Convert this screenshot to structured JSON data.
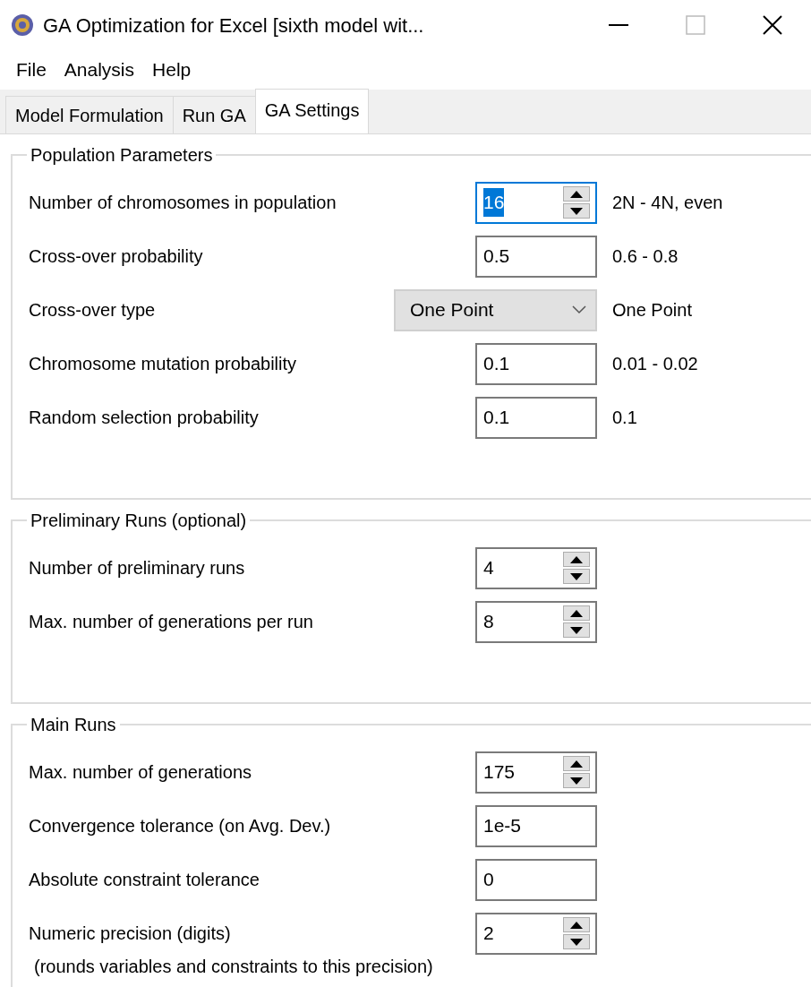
{
  "window": {
    "title": "GA Optimization for Excel [sixth model wit..."
  },
  "menu": [
    "File",
    "Analysis",
    "Help"
  ],
  "tabs": [
    {
      "label": "Model Formulation",
      "selected": false
    },
    {
      "label": "Run GA",
      "selected": false
    },
    {
      "label": "GA Settings",
      "selected": true
    }
  ],
  "groups": [
    {
      "title": "Population Parameters",
      "rows": [
        {
          "kind": "spin",
          "label": "Number of chromosomes in population",
          "value": "16",
          "hint": "2N - 4N, even",
          "focused": true
        },
        {
          "kind": "text",
          "label": "Cross-over probability",
          "value": "0.5",
          "hint": "0.6 - 0.8"
        },
        {
          "kind": "select",
          "label": "Cross-over type",
          "value": "One Point",
          "hint": "One Point"
        },
        {
          "kind": "text",
          "label": "Chromosome mutation probability",
          "value": "0.1",
          "hint": "0.01 - 0.02"
        },
        {
          "kind": "text",
          "label": "Random selection probability",
          "value": "0.1",
          "hint": "0.1"
        }
      ]
    },
    {
      "title": "Preliminary Runs (optional)",
      "rows": [
        {
          "kind": "spin",
          "label": "Number of preliminary runs",
          "value": "4"
        },
        {
          "kind": "spin",
          "label": "Max. number of generations per run",
          "value": "8"
        }
      ]
    },
    {
      "title": "Main Runs",
      "rows": [
        {
          "kind": "spin",
          "label": "Max. number of generations",
          "value": "175"
        },
        {
          "kind": "text",
          "label": "Convergence tolerance (on Avg. Dev.)",
          "value": "1e-5"
        },
        {
          "kind": "text",
          "label": "Absolute constraint tolerance",
          "value": "0"
        },
        {
          "kind": "spin",
          "label": "Numeric precision (digits)",
          "value": "2",
          "note": "(rounds variables and constraints to this precision)"
        }
      ]
    }
  ]
}
